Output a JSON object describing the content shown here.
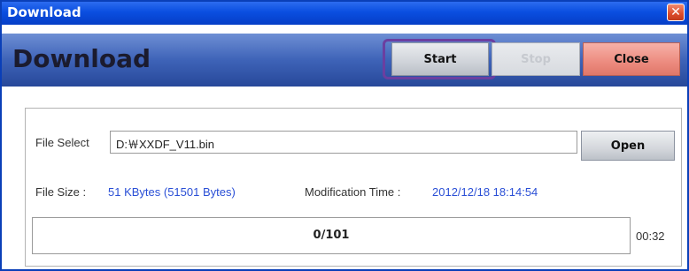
{
  "window": {
    "title": "Download",
    "close_glyph": "✕"
  },
  "header": {
    "heading": "Download",
    "start_label": "Start",
    "stop_label": "Stop",
    "close_label": "Close"
  },
  "file": {
    "select_label": "File Select",
    "path_value": "D:￦XXDF_V11.bin",
    "open_label": "Open",
    "size_label": "File Size :",
    "size_value": "51 KBytes (51501 Bytes)",
    "mod_label": "Modification Time :",
    "mod_value": "2012/12/18 18:14:54"
  },
  "progress": {
    "text": "0/101",
    "fraction": 0,
    "elapsed": "00:32"
  },
  "colors": {
    "title_bar": "#0a4ee0",
    "header": "#3e63b8",
    "info_value": "#2a4fd6",
    "close_button": "#ec8b7f",
    "focus_outline": "#6b3fa0"
  }
}
